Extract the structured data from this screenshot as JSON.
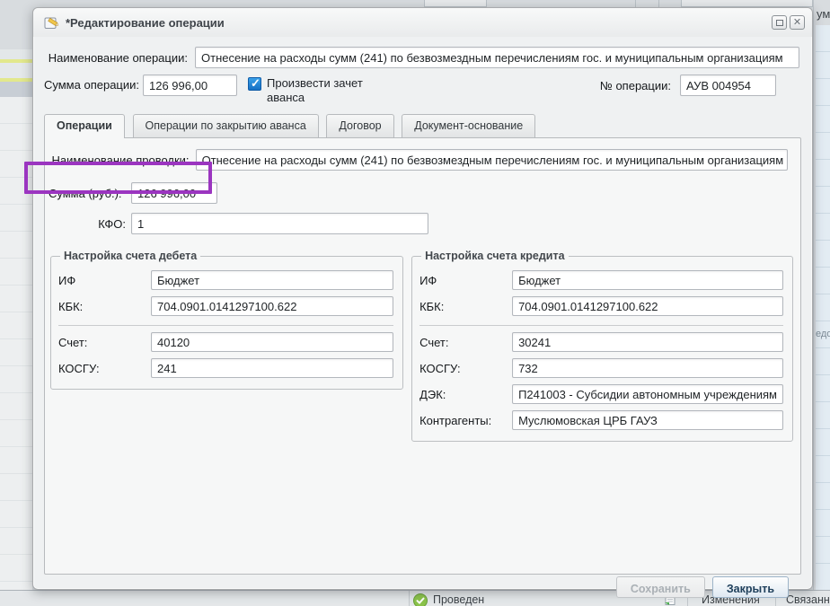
{
  "window": {
    "title": "*Редактирование операции"
  },
  "header": {
    "operation_name_label": "Наименование операции:",
    "operation_name_value": "Отнесение на расходы сумм (241) по безвозмездным перечислениям гос. и муниципальным организациям",
    "operation_sum_label": "Сумма операции:",
    "operation_sum_value": "126 996,00",
    "advance_checkbox_label": "Произвести зачет аванса",
    "advance_checkbox_checked": true,
    "operation_number_label": "№ операции:",
    "operation_number_value": "АУВ 004954"
  },
  "tabs": [
    {
      "label": "Операции",
      "active": true
    },
    {
      "label": "Операции по закрытию аванса",
      "active": false
    },
    {
      "label": "Договор",
      "active": false
    },
    {
      "label": "Документ-основание",
      "active": false
    }
  ],
  "operation_tab": {
    "posting_name_label": "Наименование проводки:",
    "posting_name_value": "Отнесение на расходы сумм (241) по безвозмездным перечислениям гос. и муниципальным организациям (",
    "sum_rub_label": "Сумма (руб.):",
    "sum_rub_value": "126 996,00",
    "kfo_label": "КФО:",
    "kfo_value": "1",
    "debit_group": {
      "title": "Настройка счета дебета",
      "fields": [
        {
          "label": "ИФ",
          "value": "Бюджет"
        },
        {
          "label": "КБК:",
          "value": "704.0901.0141297100.622"
        },
        {
          "label": "Счет:",
          "value": "40120"
        },
        {
          "label": "КОСГУ:",
          "value": "241"
        }
      ]
    },
    "credit_group": {
      "title": "Настройка счета кредита",
      "fields": [
        {
          "label": "ИФ",
          "value": "Бюджет"
        },
        {
          "label": "КБК:",
          "value": "704.0901.0141297100.622"
        },
        {
          "label": "Счет:",
          "value": "30241"
        },
        {
          "label": "КОСГУ:",
          "value": "732"
        },
        {
          "label": "ДЭК:",
          "value": "П241003 - Субсидии автономным учреждениям"
        },
        {
          "label": "Контрагенты:",
          "value": "Муслюмовская ЦРБ  ГАУЗ"
        }
      ]
    }
  },
  "footer": {
    "save_label": "Сохранить",
    "close_label": "Закрыть"
  },
  "background": {
    "status_text": "Проведен",
    "changes_label": "Изменения",
    "related_label": "Связанные",
    "top_right_text": "ум",
    "right_mid_text": "едо"
  },
  "colors": {
    "annotation_highlight": "#9b35c0",
    "checkbox_blue": "#1670c4",
    "status_green": "#7cb342"
  }
}
